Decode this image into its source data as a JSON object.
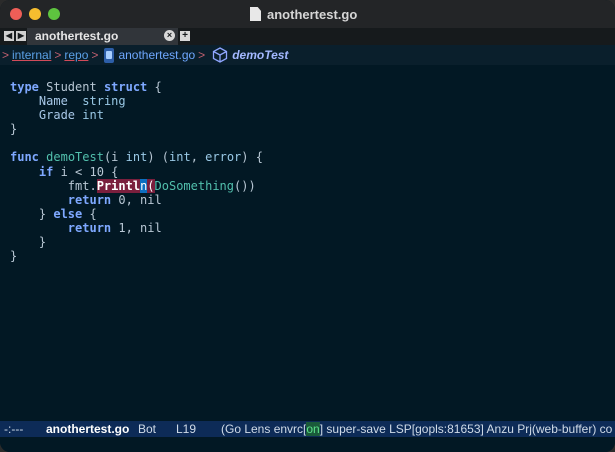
{
  "window": {
    "title": "anothertest.go"
  },
  "tabs": {
    "active_label": "anothertest.go",
    "nav_left": "◀",
    "nav_right": "▶",
    "close": "×",
    "add": "+"
  },
  "breadcrumb": {
    "items": [
      "internal",
      "repo"
    ],
    "file": "anothertest.go",
    "function": "demoTest",
    "separator": ">"
  },
  "code": {
    "lines": [
      [
        {
          "t": "kw",
          "v": "type"
        },
        {
          "t": "pl",
          "v": " Student "
        },
        {
          "t": "kw",
          "v": "struct"
        },
        {
          "t": "pl",
          "v": " {"
        }
      ],
      [
        {
          "t": "pl",
          "v": "    "
        },
        {
          "t": "nm",
          "v": "Name"
        },
        {
          "t": "pl",
          "v": "  "
        },
        {
          "t": "ty",
          "v": "string"
        }
      ],
      [
        {
          "t": "pl",
          "v": "    "
        },
        {
          "t": "nm",
          "v": "Grade"
        },
        {
          "t": "pl",
          "v": " "
        },
        {
          "t": "ty",
          "v": "int"
        }
      ],
      [
        {
          "t": "pl",
          "v": "}"
        }
      ],
      [
        {
          "t": "pl",
          "v": ""
        }
      ],
      [
        {
          "t": "kw",
          "v": "func"
        },
        {
          "t": "pl",
          "v": " "
        },
        {
          "t": "fn",
          "v": "demoTest"
        },
        {
          "t": "pl",
          "v": "(i "
        },
        {
          "t": "ty",
          "v": "int"
        },
        {
          "t": "pl",
          "v": ") ("
        },
        {
          "t": "ty",
          "v": "int"
        },
        {
          "t": "pl",
          "v": ", "
        },
        {
          "t": "ty",
          "v": "error"
        },
        {
          "t": "pl",
          "v": ") {"
        }
      ],
      [
        {
          "t": "pl",
          "v": "    "
        },
        {
          "t": "kw",
          "v": "if"
        },
        {
          "t": "pl",
          "v": " i < 10 {"
        }
      ],
      [
        {
          "t": "pl",
          "v": "        fmt."
        },
        {
          "t": "hl-a",
          "v": "Printl"
        },
        {
          "t": "hl-b",
          "v": "n"
        },
        {
          "t": "hl-c",
          "v": "("
        },
        {
          "t": "fn",
          "v": "DoSomething"
        },
        {
          "t": "pl",
          "v": "())"
        }
      ],
      [
        {
          "t": "pl",
          "v": "        "
        },
        {
          "t": "kw",
          "v": "return"
        },
        {
          "t": "pl",
          "v": " 0, nil"
        }
      ],
      [
        {
          "t": "pl",
          "v": "    } "
        },
        {
          "t": "kw",
          "v": "else"
        },
        {
          "t": "pl",
          "v": " {"
        }
      ],
      [
        {
          "t": "pl",
          "v": "        "
        },
        {
          "t": "kw",
          "v": "return"
        },
        {
          "t": "pl",
          "v": " 1, nil"
        }
      ],
      [
        {
          "t": "pl",
          "v": "    }"
        }
      ],
      [
        {
          "t": "pl",
          "v": "}"
        }
      ]
    ]
  },
  "statusbar": {
    "state": "-:---",
    "buffer": "anothertest.go",
    "position": "Bot",
    "line": "L19",
    "modes_pre": "(Go Lens envrc[",
    "modes_on": "on",
    "modes_post": "] super-save LSP[gopls:81653] Anzu Prj(web-buffer) co"
  },
  "colors": {
    "background": "#021824",
    "statusbar": "#0d2b57",
    "keyword": "#7ea8ff",
    "function": "#52c0ad"
  }
}
